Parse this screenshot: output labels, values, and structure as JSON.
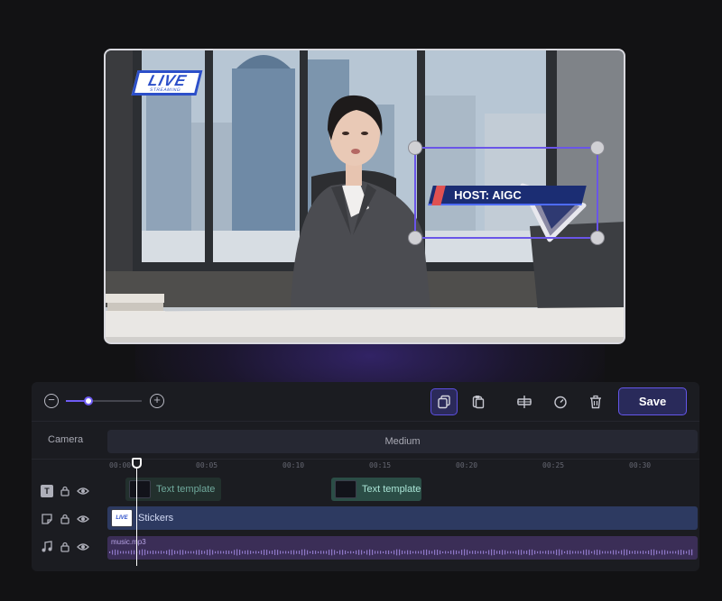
{
  "preview": {
    "live_badge": {
      "main": "LIVE",
      "sub": "STREAMING"
    },
    "lower_third": "HOST: AIGC"
  },
  "toolbar": {
    "zoom_level": 0.3,
    "save_label": "Save",
    "icons": [
      "zoom-out-icon",
      "zoom-in-icon",
      "copy-icon",
      "paste-icon",
      "split-icon",
      "speed-icon",
      "trash-icon"
    ]
  },
  "timeline": {
    "camera_label": "Camera",
    "camera_clip": "Medium",
    "ruler": [
      "00:00",
      "00:05",
      "00:10",
      "00:15",
      "00:20",
      "00:25",
      "00:30"
    ],
    "text_clips": [
      "Text template",
      "Text template"
    ],
    "sticker_clip": "Stickers",
    "sticker_thumb": "LIVE",
    "music_clip": "music.mp3"
  },
  "colors": {
    "accent": "#6f5cf5",
    "text_clip": "#2b4d46",
    "sticker_clip": "#2d3a61",
    "music_clip": "#3b2e57"
  }
}
